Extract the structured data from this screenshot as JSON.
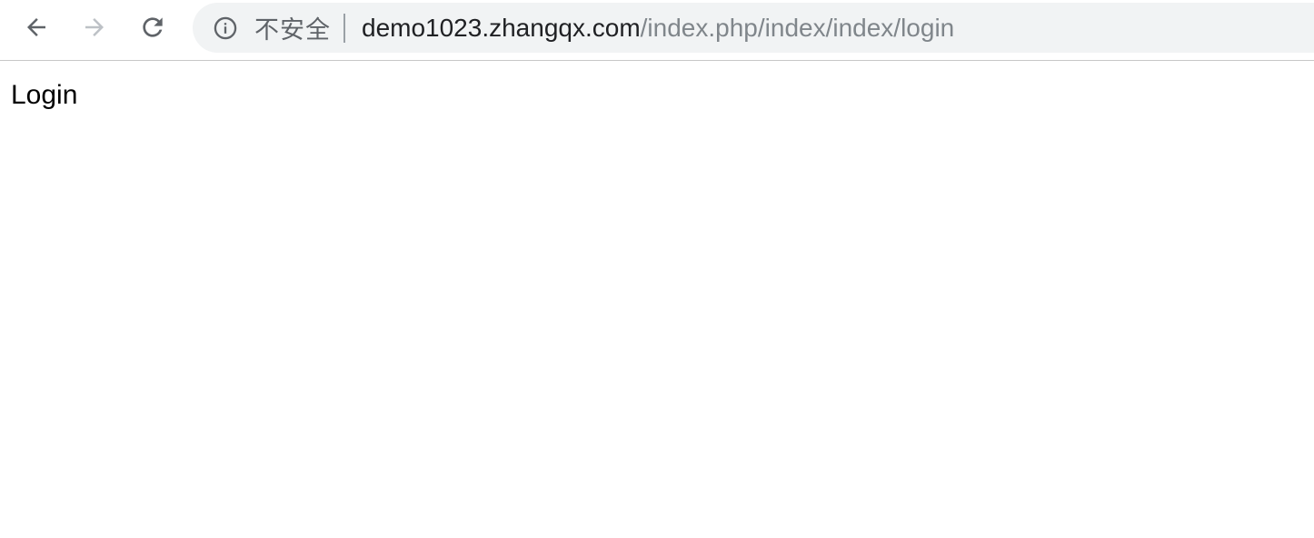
{
  "browser": {
    "security_text": "不安全",
    "url_host": "demo1023.zhangqx.com",
    "url_path": "/index.php/index/index/login",
    "icons": {
      "back": "back-arrow-icon",
      "forward": "forward-arrow-icon",
      "reload": "reload-icon",
      "info": "info-icon"
    },
    "colors": {
      "omnibox_bg": "#f1f3f4",
      "icon_active": "#5f6368",
      "icon_disabled": "#bdc1c6",
      "path_text": "#80868b"
    }
  },
  "page": {
    "body_text": "Login"
  }
}
